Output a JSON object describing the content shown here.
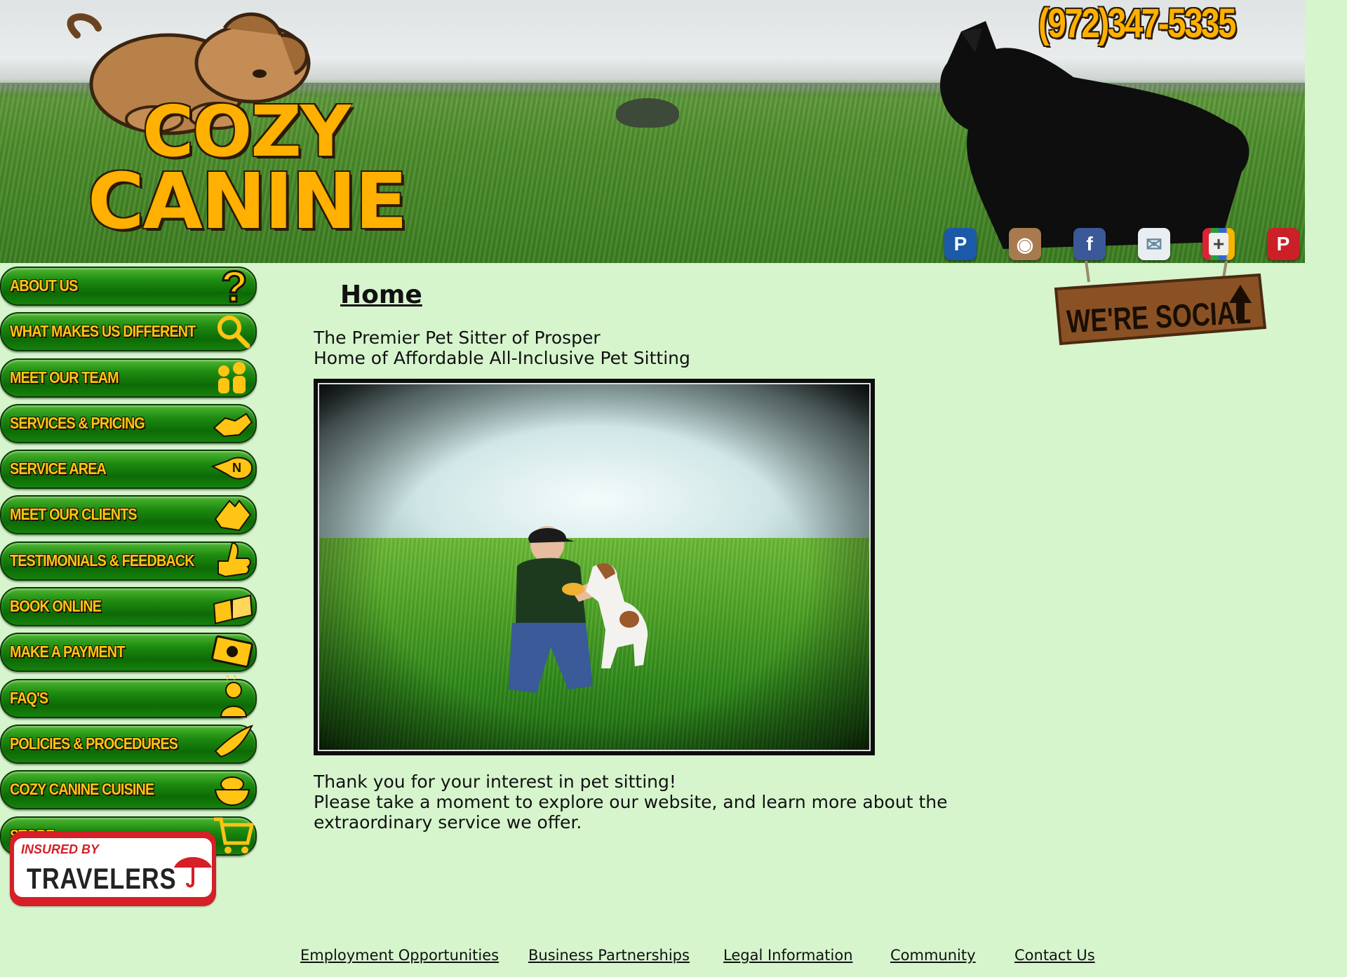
{
  "header": {
    "logo_line1": "COZY",
    "logo_line2": "CANINE",
    "phone": "(972)347-5335",
    "social_icons": [
      {
        "icon": "paypal-icon",
        "glyph": "P",
        "color": "#1b5aa8"
      },
      {
        "icon": "instagram-icon",
        "glyph": "◉",
        "color": "#a87a4f"
      },
      {
        "icon": "facebook-icon",
        "glyph": "f",
        "color": "#3b5998"
      },
      {
        "icon": "email-icon",
        "glyph": "✉",
        "color": "#e8eef2"
      },
      {
        "icon": "google-plus-icon",
        "glyph": "+",
        "color": "#8a8a8a"
      },
      {
        "icon": "pinterest-icon",
        "glyph": "P",
        "color": "#cb2027"
      }
    ],
    "social_sign": "WE'RE SOCIAL"
  },
  "nav": {
    "items": [
      {
        "label": "ABOUT US",
        "icon": "question-mark-icon"
      },
      {
        "label": "WHAT MAKES US DIFFERENT",
        "icon": "magnifier-icon"
      },
      {
        "label": "MEET OUR TEAM",
        "icon": "people-icon"
      },
      {
        "label": "SERVICES & PRICING",
        "icon": "handshake-icon"
      },
      {
        "label": "SERVICE AREA",
        "icon": "compass-icon"
      },
      {
        "label": "MEET OUR CLIENTS",
        "icon": "dog-icon"
      },
      {
        "label": "TESTIMONIALS & FEEDBACK",
        "icon": "thumbs-up-icon"
      },
      {
        "label": "BOOK ONLINE",
        "icon": "book-icon"
      },
      {
        "label": "MAKE A PAYMENT",
        "icon": "money-icon"
      },
      {
        "label": "FAQ'S",
        "icon": "thinking-person-icon"
      },
      {
        "label": "POLICIES & PROCEDURES",
        "icon": "quill-icon"
      },
      {
        "label": "COZY CANINE CUISINE",
        "icon": "food-bowl-icon"
      },
      {
        "label": "STORE",
        "icon": "shopping-cart-icon"
      }
    ],
    "badge_insured": "INSURED BY",
    "badge_name": "TRAVELERS"
  },
  "main": {
    "title": "Home",
    "tagline_1": "The Premier Pet Sitter of Prosper",
    "tagline_2": "Home of Affordable All-Inclusive Pet Sitting",
    "body_1": "Thank you for your interest in pet sitting!",
    "body_2": "Please take a moment to explore our website, and learn more about the extraordinary service we offer."
  },
  "footer": {
    "links": [
      "Employment Opportunities",
      "Business Partnerships",
      "Legal Information",
      "Community",
      "Contact Us"
    ]
  }
}
